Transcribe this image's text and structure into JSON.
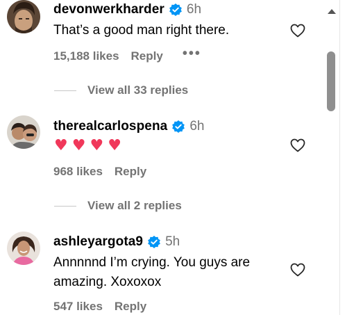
{
  "comments": [
    {
      "username": "devonwerkharder",
      "time": "6h",
      "text": "That’s a good man right there.",
      "likes": "15,188 likes",
      "reply_label": "Reply",
      "more_label": "•••",
      "view_replies": "View all 33 replies"
    },
    {
      "username": "therealcarlospena",
      "time": "6h",
      "emoji": [
        "♥",
        "♥",
        "♥",
        "♥"
      ],
      "likes": "968 likes",
      "reply_label": "Reply",
      "view_replies": "View all 2 replies"
    },
    {
      "username": "ashleyargota9",
      "time": "5h",
      "text": "Annnnnd I’m crying. You guys are amazing. Xoxoxox",
      "likes": "547 likes",
      "reply_label": "Reply"
    }
  ],
  "icons": {
    "verified": "verified-badge-icon",
    "like": "heart-outline-icon",
    "emoji_heart": "pink-heart-emoji"
  },
  "colors": {
    "verified": "#0095f6",
    "secondary_text": "#737373",
    "emoji_heart": "#f0385a"
  }
}
